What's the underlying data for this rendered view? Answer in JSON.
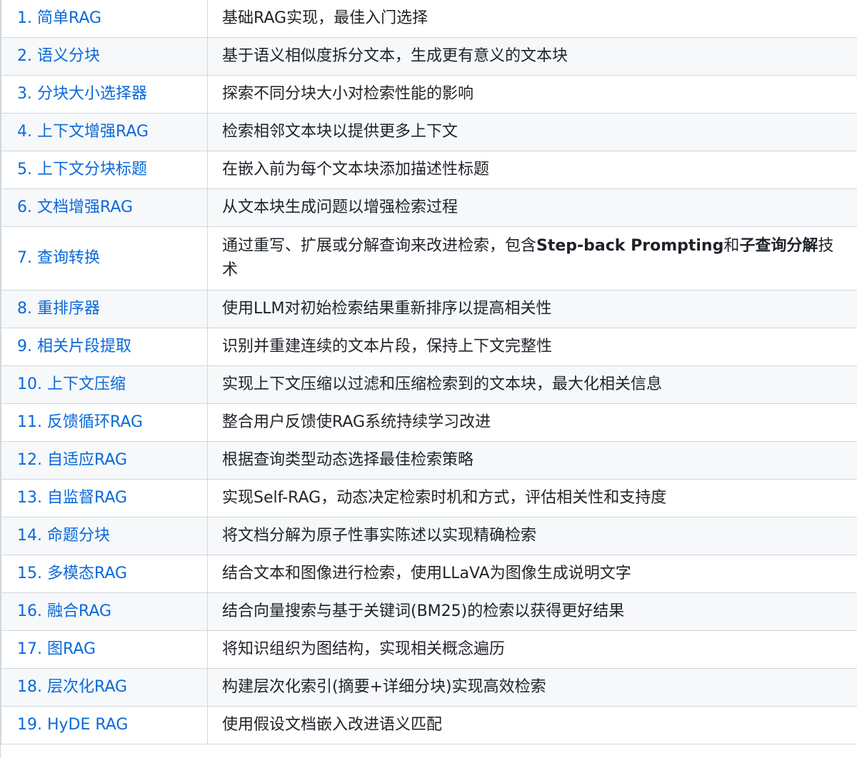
{
  "rows": [
    {
      "name": "1. 简单RAG",
      "desc": [
        {
          "t": "基础RAG实现，最佳入门选择"
        }
      ]
    },
    {
      "name": "2. 语义分块",
      "desc": [
        {
          "t": "基于语义相似度拆分文本，生成更有意义的文本块"
        }
      ]
    },
    {
      "name": "3. 分块大小选择器",
      "desc": [
        {
          "t": "探索不同分块大小对检索性能的影响"
        }
      ]
    },
    {
      "name": "4. 上下文增强RAG",
      "desc": [
        {
          "t": "检索相邻文本块以提供更多上下文"
        }
      ]
    },
    {
      "name": "5. 上下文分块标题",
      "desc": [
        {
          "t": "在嵌入前为每个文本块添加描述性标题"
        }
      ]
    },
    {
      "name": "6. 文档增强RAG",
      "desc": [
        {
          "t": "从文本块生成问题以增强检索过程"
        }
      ]
    },
    {
      "name": "7. 查询转换",
      "desc": [
        {
          "t": "通过重写、扩展或分解查询来改进检索，包含"
        },
        {
          "t": "Step-back Prompting",
          "bold": true
        },
        {
          "t": "和"
        },
        {
          "t": "子查询分解",
          "bold": true
        },
        {
          "t": "技术"
        }
      ]
    },
    {
      "name": "8. 重排序器",
      "desc": [
        {
          "t": "使用LLM对初始检索结果重新排序以提高相关性"
        }
      ]
    },
    {
      "name": "9. 相关片段提取",
      "desc": [
        {
          "t": "识别并重建连续的文本片段，保持上下文完整性"
        }
      ]
    },
    {
      "name": "10. 上下文压缩",
      "desc": [
        {
          "t": "实现上下文压缩以过滤和压缩检索到的文本块，最大化相关信息"
        }
      ]
    },
    {
      "name": "11. 反馈循环RAG",
      "desc": [
        {
          "t": "整合用户反馈使RAG系统持续学习改进"
        }
      ]
    },
    {
      "name": "12. 自适应RAG",
      "desc": [
        {
          "t": "根据查询类型动态选择最佳检索策略"
        }
      ]
    },
    {
      "name": "13. 自监督RAG",
      "desc": [
        {
          "t": "实现Self-RAG，动态决定检索时机和方式，评估相关性和支持度"
        }
      ]
    },
    {
      "name": "14. 命题分块",
      "desc": [
        {
          "t": "将文档分解为原子性事实陈述以实现精确检索"
        }
      ]
    },
    {
      "name": "15. 多模态RAG",
      "desc": [
        {
          "t": "结合文本和图像进行检索，使用LLaVA为图像生成说明文字"
        }
      ]
    },
    {
      "name": "16. 融合RAG",
      "desc": [
        {
          "t": "结合向量搜索与基于关键词(BM25)的检索以获得更好结果"
        }
      ]
    },
    {
      "name": "17. 图RAG",
      "desc": [
        {
          "t": "将知识组织为图结构，实现相关概念遍历"
        }
      ]
    },
    {
      "name": "18. 层次化RAG",
      "desc": [
        {
          "t": "构建层次化索引(摘要+详细分块)实现高效检索"
        }
      ]
    },
    {
      "name": "19. HyDE RAG",
      "desc": [
        {
          "t": "使用假设文档嵌入改进语义匹配"
        }
      ]
    }
  ],
  "colors": {
    "link": "#0969da",
    "text": "#1f2328",
    "border": "#d0d7de",
    "stripe": "#f6f8fa"
  }
}
